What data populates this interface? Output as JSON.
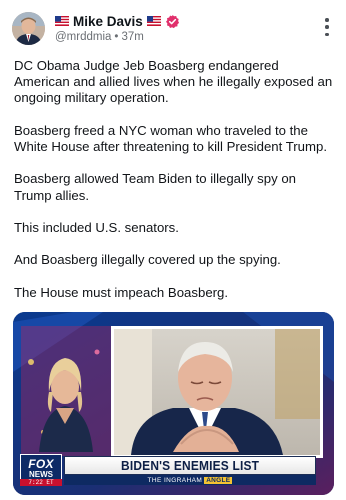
{
  "post": {
    "author": {
      "name": "Mike Davis",
      "handle": "@mrddmia",
      "time": "37m"
    },
    "body": [
      "DC Obama Judge Jeb Boasberg endangered American and allied lives when he illegally exposed an ongoing military operation.",
      "Boasberg freed a NYC woman who traveled to the White House after threatening to kill President Trump.",
      "Boasberg allowed Team Biden to illegally spy on Trump allies.",
      "This included U.S. senators.",
      "And Boasberg illegally covered up the spying.",
      "The House must impeach Boasberg."
    ],
    "media": {
      "network_logo_line1": "FOX",
      "network_logo_line2": "NEWS",
      "clock": "7:22 ET",
      "banner": "BIDEN'S ENEMIES LIST",
      "show_prefix": "THE INGRAHAM",
      "show_suffix": "ANGLE"
    }
  },
  "colors": {
    "verified_badge": "#e1306c",
    "network_blue": "#0d2a66",
    "banner_text": "#0d1f45",
    "show_accent": "#f3c332"
  },
  "icons": [
    "us-flag-icon",
    "verified-badge-icon",
    "more-options-icon"
  ]
}
